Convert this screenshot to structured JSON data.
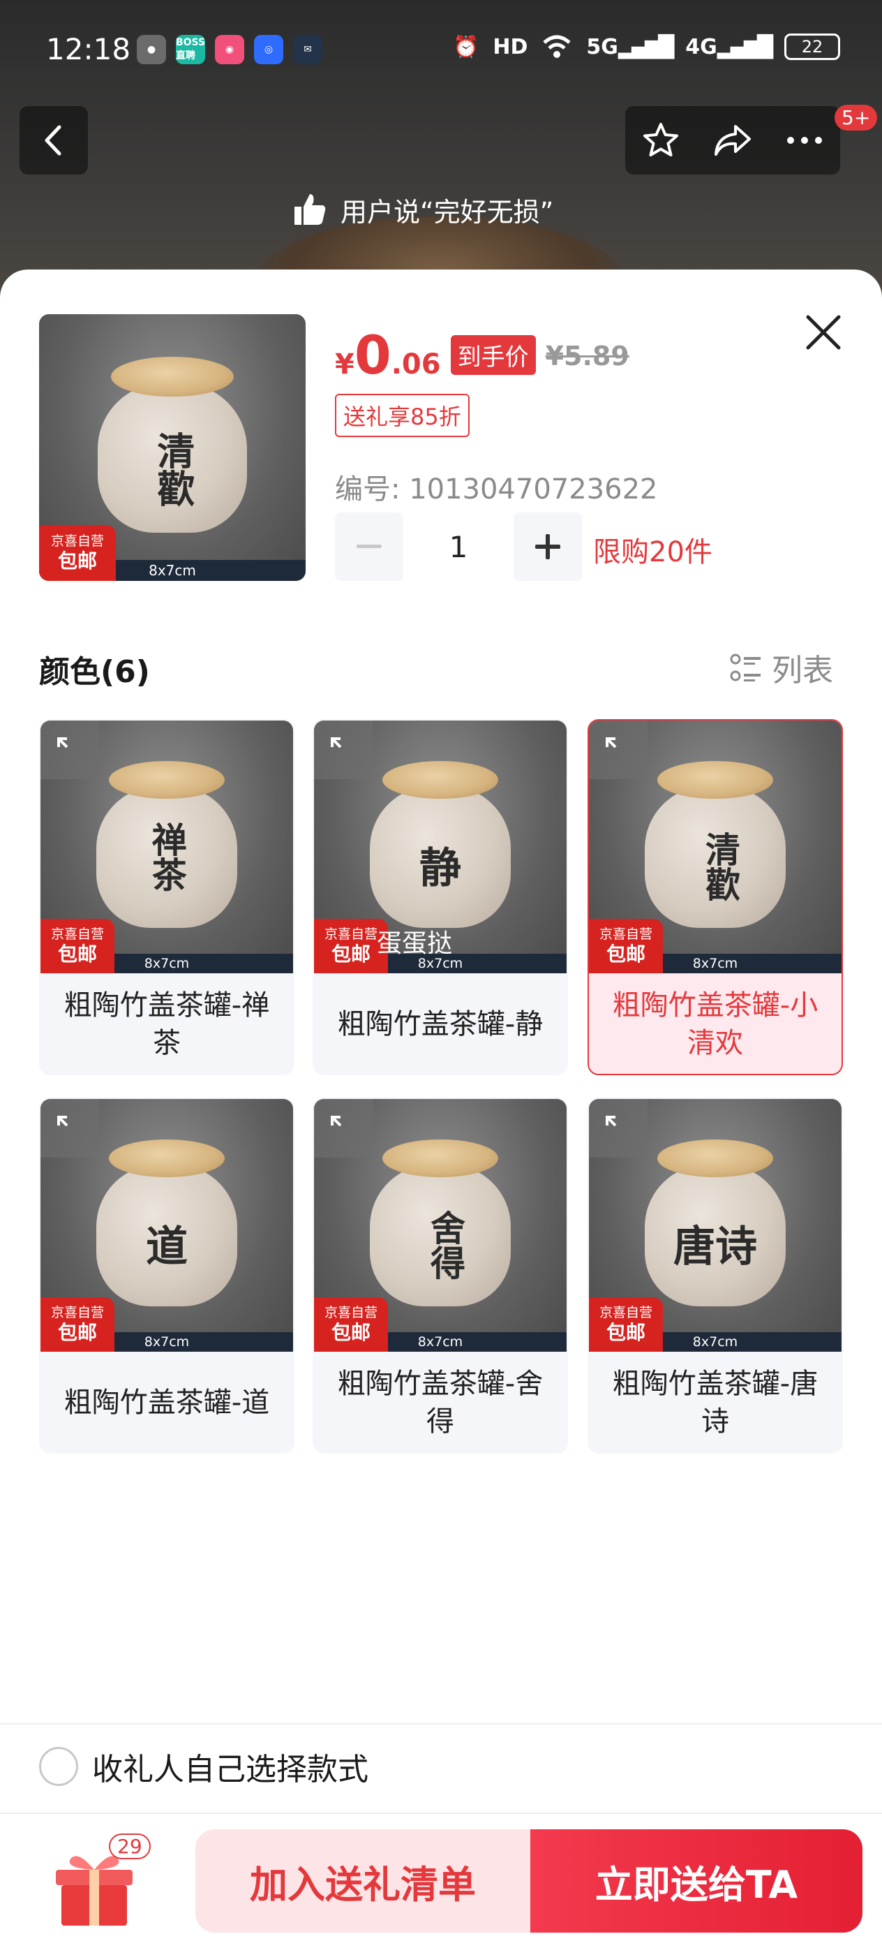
{
  "status_bar": {
    "time": "12:18",
    "app_icons": [
      {
        "name": "wechat-icon",
        "color": "#6b6b6b"
      },
      {
        "name": "boss-zhipin-icon",
        "label": "BOSS直聘",
        "color": "#1bb9a4"
      },
      {
        "name": "app-pink-icon",
        "color": "#f0507a"
      },
      {
        "name": "app-blue-icon",
        "color": "#2f6bff"
      },
      {
        "name": "app-dark-icon",
        "color": "#22334a"
      }
    ],
    "battery": "22",
    "network_labels": [
      "HD",
      "5G",
      "4G"
    ]
  },
  "header": {
    "badge": "5+",
    "review_tag": "用户说“完好无损”"
  },
  "product": {
    "price_symbol": "¥",
    "price_int": "0",
    "price_dec": ".06",
    "price_tag": "到手价",
    "original_price": "¥5.89",
    "gift_badge": "送礼享85折",
    "sku_label": "编号: 10130470723622",
    "quantity": "1",
    "limit": "限购20件",
    "size_label": "8x7cm",
    "jd_badge_line1": "京喜自营",
    "jd_badge_line2": "包邮",
    "jar_text": "清歡"
  },
  "section": {
    "title": "颜色(6)",
    "list_toggle": "列表"
  },
  "variants": [
    {
      "name": "粗陶竹盖茶罐-禅茶",
      "jar_text": "禅茶",
      "size": "8x7cm",
      "badge_line1": "京喜自营",
      "badge_line2": "包邮",
      "selected": false
    },
    {
      "name": "粗陶竹盖茶罐-静",
      "jar_text": "静",
      "size": "8x7cm",
      "badge_line1": "京喜自营",
      "badge_line2": "包邮",
      "overlay": "蛋蛋挞",
      "selected": false
    },
    {
      "name": "粗陶竹盖茶罐-小清欢",
      "jar_text": "清歡",
      "size": "8x7cm",
      "badge_line1": "京喜自营",
      "badge_line2": "包邮",
      "selected": true
    },
    {
      "name": "粗陶竹盖茶罐-道",
      "jar_text": "道",
      "size": "8x7cm",
      "badge_line1": "京喜自营",
      "badge_line2": "包邮",
      "selected": false
    },
    {
      "name": "粗陶竹盖茶罐-舍得",
      "jar_text": "舍得",
      "size": "8x7cm",
      "badge_line1": "京喜自营",
      "badge_line2": "包邮",
      "selected": false
    },
    {
      "name": "粗陶竹盖茶罐-唐诗",
      "jar_text": "唐诗",
      "size": "8x7cm",
      "badge_line1": "京喜自营",
      "badge_line2": "包邮",
      "selected": false
    }
  ],
  "footer": {
    "radio_label": "收礼人自己选择款式",
    "cart_count": "29",
    "add_button": "加入送礼清单",
    "send_button": "立即送给TA"
  },
  "colors": {
    "accent": "#e4393c",
    "selected_bg": "#fde9ee",
    "add_button_bg": "#fde4e7"
  }
}
